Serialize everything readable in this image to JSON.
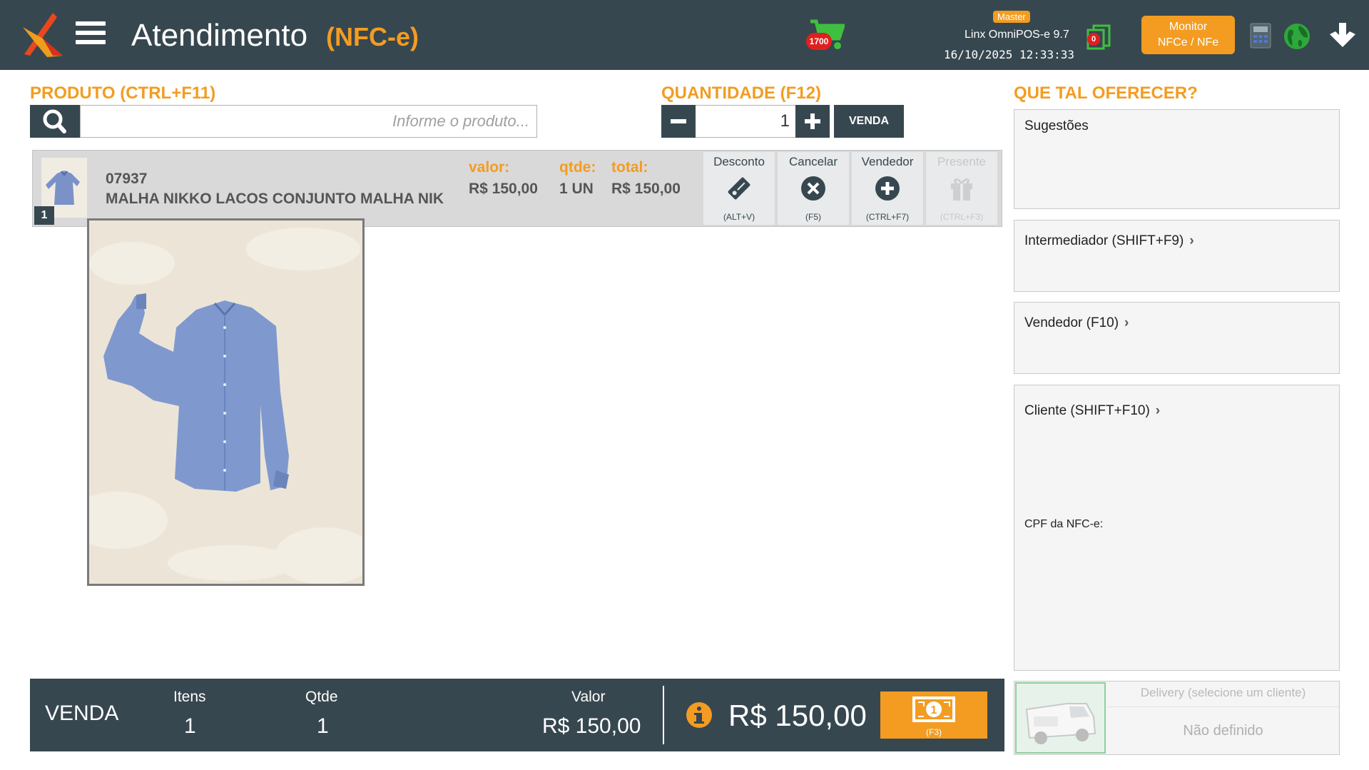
{
  "header": {
    "title": "Atendimento",
    "subtitle": "(NFC-e)",
    "cart_count": "1700",
    "badge": "Master",
    "version": "Linx OmniPOS-e  9.7",
    "datetime": "16/10/2025 12:33:33",
    "docs_count": "0",
    "monitor_line1": "Monitor",
    "monitor_line2": "NFCe / NFe"
  },
  "product": {
    "label": "PRODUTO (CTRL+F11)",
    "placeholder": "Informe o produto..."
  },
  "quantity": {
    "label": "QUANTIDADE (F12)",
    "value": "1",
    "venda_button": "VENDA"
  },
  "item": {
    "index": "1",
    "code": "07937",
    "description": "MALHA NIKKO LACOS CONJUNTO MALHA NIK",
    "valor_label": "valor:",
    "valor": "R$ 150,00",
    "qtde_label": "qtde:",
    "qtde": "1 UN",
    "total_label": "total:",
    "total": "R$ 150,00",
    "actions": [
      {
        "label": "Desconto",
        "key": "(ALT+V)"
      },
      {
        "label": "Cancelar",
        "key": "(F5)"
      },
      {
        "label": "Vendedor",
        "key": "(CTRL+F7)"
      },
      {
        "label": "Presente",
        "key": "(CTRL+F3)"
      }
    ]
  },
  "side": {
    "label": "QUE TAL OFERECER?",
    "sugestoes": "Sugestões",
    "intermediador": "Intermediador (SHIFT+F9)",
    "vendedor": "Vendedor (F10)",
    "cliente": "Cliente (SHIFT+F10)",
    "cpf": "CPF da NFC-e:",
    "chevron": "›"
  },
  "summary": {
    "title": "VENDA",
    "itens_label": "Itens",
    "itens": "1",
    "qtde_label": "Qtde",
    "qtde": "1",
    "valor_label": "Valor",
    "valor": "R$ 150,00",
    "total": "R$ 150,00",
    "pay_key": "(F3)"
  },
  "delivery": {
    "title": "Delivery (selecione um cliente)",
    "value": "Não definido"
  },
  "colors": {
    "header_bg": "#37474f",
    "accent": "#f39c21",
    "cart_green": "#3fbf3f",
    "badge_red": "#e02020"
  }
}
